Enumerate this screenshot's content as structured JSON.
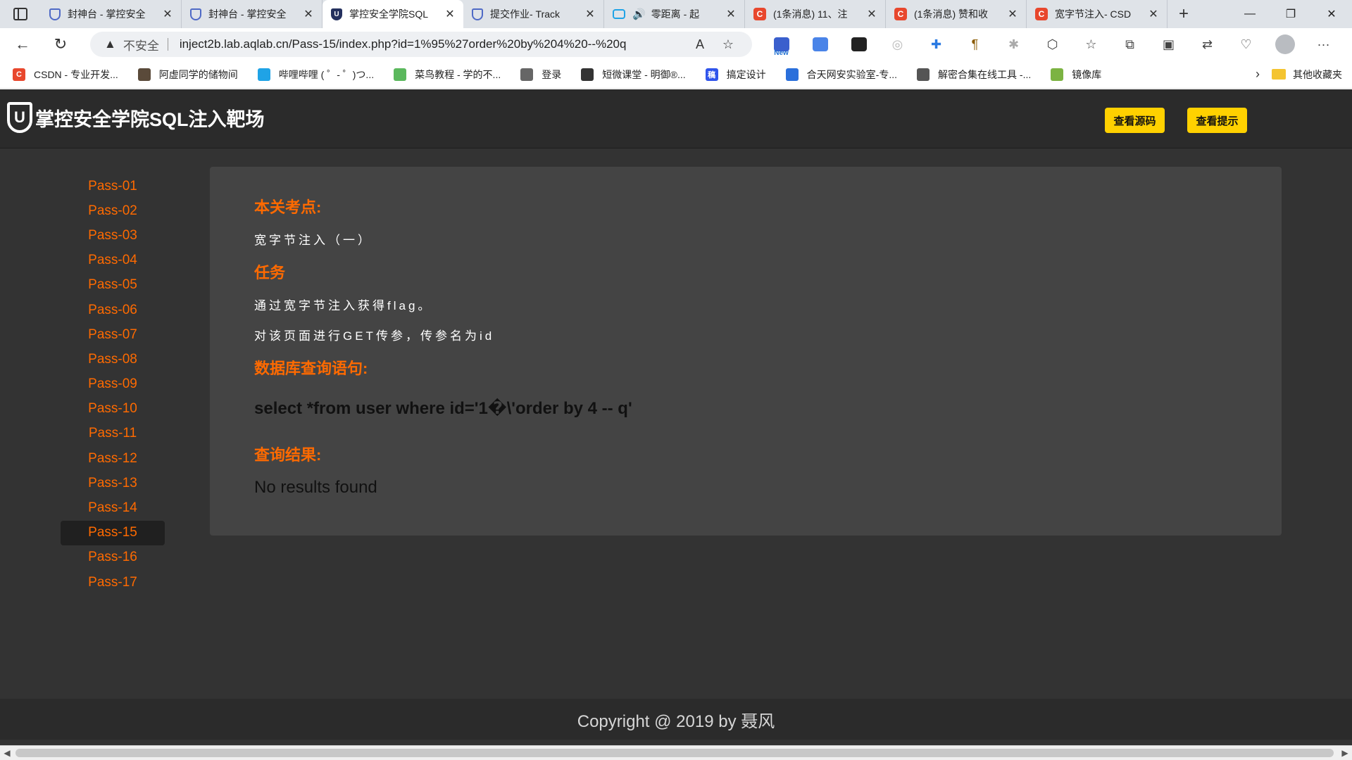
{
  "browser": {
    "tabs": [
      {
        "title": "封神台 - 掌控安全",
        "icon": "shield-icon",
        "active": false
      },
      {
        "title": "封神台 - 掌控安全",
        "icon": "shield-icon",
        "active": false
      },
      {
        "title": "掌控安全学院SQL",
        "icon": "shield-icon",
        "active": true
      },
      {
        "title": "提交作业- Track",
        "icon": "shield-icon",
        "active": false
      },
      {
        "title": "零距离 - 起",
        "icon": "tv-icon",
        "active": false,
        "audio": true
      },
      {
        "title": "(1条消息) 11、注",
        "icon": "csdn-icon",
        "active": false
      },
      {
        "title": "(1条消息) 赞和收",
        "icon": "csdn-icon",
        "active": false
      },
      {
        "title": "宽字节注入- CSD",
        "icon": "csdn-icon",
        "active": false
      }
    ],
    "address": {
      "security_label": "不安全",
      "url": "inject2b.lab.aqlab.cn/Pass-15/index.php?id=1%95%27order%20by%204%20--%20q"
    },
    "ext_new_badge": "New",
    "bookmarks": [
      {
        "label": "CSDN - 专业开发...",
        "color": "#e8472d",
        "glyph": "C"
      },
      {
        "label": "阿虚同学的储物间",
        "color": "#5a4a3a",
        "glyph": ""
      },
      {
        "label": "哔哩哔哩 ( ゜- ゜)つ...",
        "color": "#1fa3e6",
        "glyph": ""
      },
      {
        "label": "菜鸟教程 - 学的不...",
        "color": "#5bb85d",
        "glyph": ""
      },
      {
        "label": "登录",
        "color": "#666666",
        "glyph": ""
      },
      {
        "label": "短微课堂 - 明御®...",
        "color": "#333333",
        "glyph": ""
      },
      {
        "label": "搞定设计",
        "color": "#2f54eb",
        "glyph": "稿"
      },
      {
        "label": "合天网安实验室-专...",
        "color": "#2a6fdb",
        "glyph": ""
      },
      {
        "label": "解密合集在线工具 -...",
        "color": "#555555",
        "glyph": ""
      },
      {
        "label": "镜像库",
        "color": "#7cb342",
        "glyph": ""
      }
    ],
    "other_bookmarks": "其他收藏夹"
  },
  "site": {
    "logo_mark": "U",
    "logo_text": "掌控安全学院SQL注入靶场",
    "btn_source": "查看源码",
    "btn_hint": "查看提示",
    "nav": [
      "Pass-01",
      "Pass-02",
      "Pass-03",
      "Pass-04",
      "Pass-05",
      "Pass-06",
      "Pass-07",
      "Pass-08",
      "Pass-09",
      "Pass-10",
      "Pass-11",
      "Pass-12",
      "Pass-13",
      "Pass-14",
      "Pass-15",
      "Pass-16",
      "Pass-17"
    ],
    "active_nav": "Pass-15",
    "panel": {
      "topic_title": "本关考点:",
      "topic_text": "宽字节注入（一）",
      "task_title": "任务",
      "task_line1": "通过宽字节注入获得flag。",
      "task_line2": "对该页面进行GET传参，传参名为id",
      "query_title": "数据库查询语句:",
      "query": "select *from user where id='1�\\'order by 4 -- q'",
      "result_title": "查询结果:",
      "result": "No results found"
    },
    "footer": "Copyright @ 2019 by 聂风"
  }
}
